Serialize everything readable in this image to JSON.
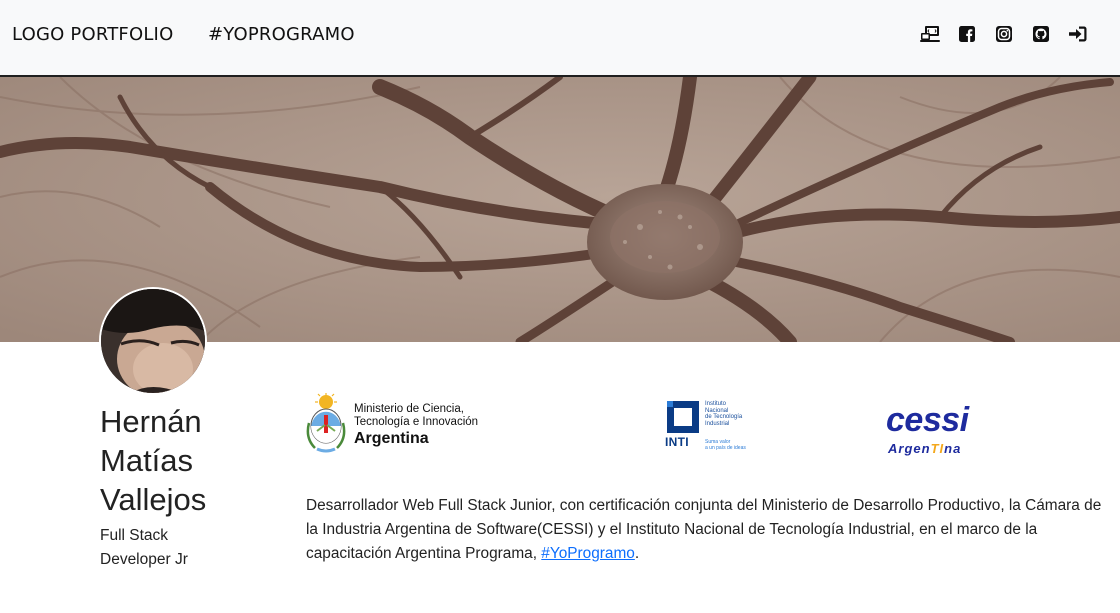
{
  "navbar": {
    "brand": "LOGO PORTFOLIO",
    "link": "#YOPROGRAMO",
    "icons": [
      "laptop-code-icon",
      "facebook-icon",
      "instagram-icon",
      "github-icon",
      "sign-in-icon"
    ]
  },
  "banner": {
    "image": "neuron-photo"
  },
  "profile": {
    "name_line1": "Hernán",
    "name_line2": "Matías",
    "name_line3": "Vallejos",
    "role_line1": "Full Stack",
    "role_line2": "Developer Jr"
  },
  "logos": {
    "ministerio": {
      "line1": "Ministerio de Ciencia,",
      "line2": "Tecnología e Innovación",
      "line3": "Argentina"
    },
    "inti": {
      "line1": "Instituto",
      "line2": "Nacional",
      "line3": "de Tecnología",
      "line4": "Industrial",
      "word": "INTI",
      "slogan1": "Suma valor",
      "slogan2": "a un país de ideas"
    },
    "cessi": {
      "word": "cessi",
      "sub_a": "Argen",
      "sub_b": "TI",
      "sub_c": "na"
    }
  },
  "about": {
    "text": "Desarrollador Web Full Stack Junior, con certificación conjunta del Ministerio de Desarrollo Productivo, la Cámara de la Industria Argentina de Software(CESSI) y el Instituto Nacional de Tecnología Industrial, en el marco de la capacitación Argentina Programa, ",
    "link": "#YoProgramo",
    "end": "."
  },
  "colors": {
    "navbar_bg": "#f8f9fa",
    "banner_tone": "#a99487",
    "link": "#0d6efd",
    "cessi_blue": "#1e2b9e",
    "inti_blue": "#0a3b85"
  }
}
